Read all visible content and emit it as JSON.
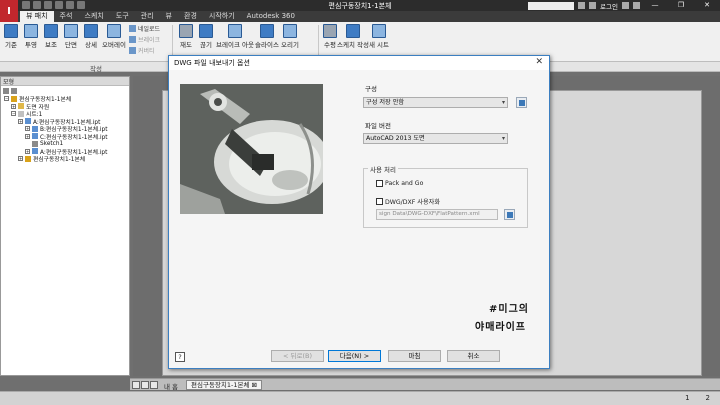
{
  "app": {
    "logo_text": "I",
    "window_title": "편심구동장치1-1본체",
    "login_label": "로그인",
    "window_controls": [
      "—",
      "❐",
      "✕"
    ]
  },
  "ribbon_tabs": [
    "뷰 패치",
    "주석",
    "스케치",
    "도구",
    "관리",
    "뷰",
    "환경",
    "시작하기",
    "Autodesk 360"
  ],
  "ribbon": {
    "main_buttons": [
      "기준",
      "투영",
      "보조",
      "단면",
      "상세",
      "오버레이"
    ],
    "small_items": [
      {
        "label": "네일로드",
        "dim": false
      },
      {
        "label": "브레이크",
        "dim": true
      },
      {
        "label": "커버티",
        "dim": true
      }
    ],
    "second_buttons": [
      "재도",
      "끊기",
      "브레이크 아웃",
      "슬라이스",
      "오리기"
    ],
    "third_buttons": [
      "수평",
      "스케치 작성",
      "새 시트"
    ],
    "panel_label": "작성"
  },
  "browser": {
    "title": "모형",
    "items": [
      {
        "label": "편심구동장치1-1본체",
        "indent": 0,
        "pm": "−",
        "icon_color": "#d9a21b"
      },
      {
        "label": "도면 자원",
        "indent": 1,
        "pm": "+",
        "icon_color": "#e0b84a"
      },
      {
        "label": "시트:1",
        "indent": 1,
        "pm": "−",
        "icon_color": "#c0c0c0"
      },
      {
        "label": "A:편심구동장치1-1본체.ipt",
        "indent": 2,
        "pm": "+",
        "icon_color": "#5a8fd1"
      },
      {
        "label": "B:편심구동장치1-1본체.ipt",
        "indent": 3,
        "pm": "+",
        "icon_color": "#5a8fd1"
      },
      {
        "label": "C:편심구동장치1-1본체.ipt",
        "indent": 3,
        "pm": "+",
        "icon_color": "#5a8fd1"
      },
      {
        "label": "Sketch1",
        "indent": 3,
        "pm": "",
        "icon_color": "#8a8a8a"
      },
      {
        "label": "A:편심구동장치1-1본체.ipt",
        "indent": 3,
        "pm": "+",
        "icon_color": "#5a8fd1"
      },
      {
        "label": "편심구동장치1-1본체",
        "indent": 2,
        "pm": "+",
        "icon_color": "#d9a21b"
      }
    ]
  },
  "doctabs": {
    "home_label": "내 홈",
    "active_tab": "편심구동장치1-1본체 ⊠"
  },
  "status": {
    "ready_text": "",
    "numbers": [
      "1",
      "2"
    ]
  },
  "dialog": {
    "title": "DWG 파일 내보내기 옵션",
    "close": "✕",
    "config_label": "구성",
    "config_value": "구성 저장 안함",
    "file_version_label": "파일 버전",
    "file_version_value": "AutoCAD 2013 도면",
    "custom_label": "사용 처리",
    "pack_and_go": "Pack and Go",
    "dwg_custom": "DWG/DXF 사용자화",
    "path_value": "sign Data\\DWG-DXF\\FlatPattern.xml",
    "help": "?",
    "buttons": {
      "back": "< 뒤로(B)",
      "next": "다음(N) >",
      "finish": "마침",
      "cancel": "취소"
    },
    "watermark_line1": "#미그의",
    "watermark_line2": "야매라이프"
  }
}
